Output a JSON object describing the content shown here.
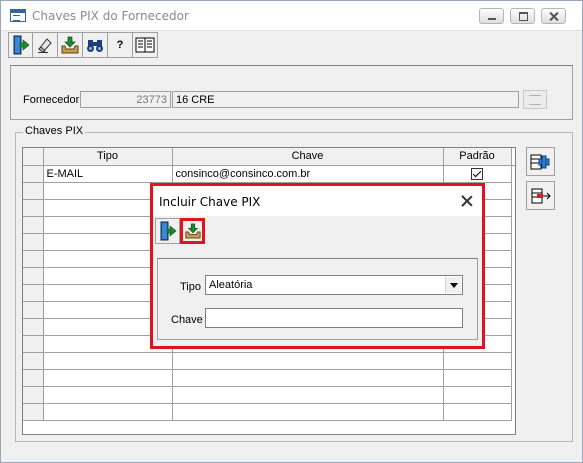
{
  "window": {
    "title": "Chaves PIX do Fornecedor"
  },
  "toolbar": {
    "items": [
      {
        "icon": "exit-door-icon"
      },
      {
        "icon": "eraser-icon"
      },
      {
        "icon": "save-tray-icon"
      },
      {
        "icon": "binoculars-icon"
      },
      {
        "icon": "help-icon",
        "label": "?"
      },
      {
        "icon": "manual-book-icon"
      }
    ]
  },
  "supplier": {
    "label": "Fornecedor",
    "code": "23773",
    "name": "16 CRE"
  },
  "pix_group": {
    "label": "Chaves PIX",
    "columns": [
      "Tipo",
      "Chave",
      "Padrão"
    ],
    "rows": [
      {
        "tipo": "E-MAIL",
        "chave": "consinco@consinco.com.br",
        "padrao": true
      }
    ]
  },
  "side_buttons": [
    {
      "icon": "add-row-icon"
    },
    {
      "icon": "remove-row-icon"
    }
  ],
  "dialog": {
    "title": "Incluir Chave PIX",
    "tipo_label": "Tipo",
    "tipo_value": "Aleatória",
    "chave_label": "Chave",
    "chave_value": ""
  },
  "colors": {
    "highlight": "#e0141e"
  }
}
